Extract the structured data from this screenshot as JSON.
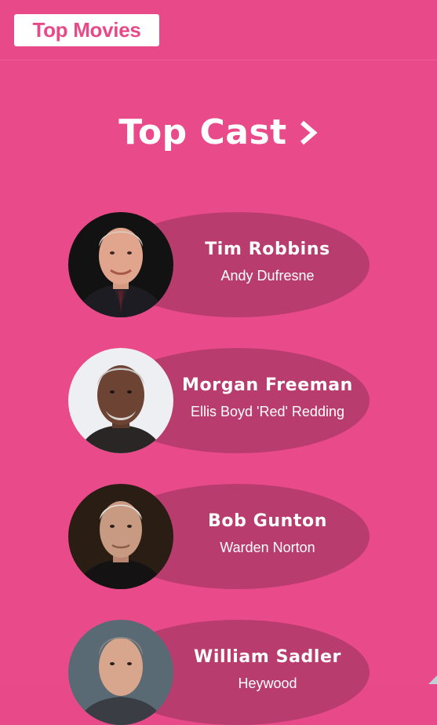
{
  "app": {
    "brand_label": "Top Movies"
  },
  "section": {
    "title": "Top Cast"
  },
  "cast": [
    {
      "actor": "Tim Robbins",
      "role": "Andy Dufresne",
      "avatar_icon": "actor-photo-icon"
    },
    {
      "actor": "Morgan Freeman",
      "role": "Ellis Boyd 'Red' Redding",
      "avatar_icon": "actor-photo-icon"
    },
    {
      "actor": "Bob Gunton",
      "role": "Warden Norton",
      "avatar_icon": "actor-photo-icon"
    },
    {
      "actor": "William Sadler",
      "role": "Heywood",
      "avatar_icon": "actor-photo-icon"
    }
  ],
  "colors": {
    "background": "#e94a8a",
    "card": "#b93c6f",
    "text": "#ffffff"
  }
}
